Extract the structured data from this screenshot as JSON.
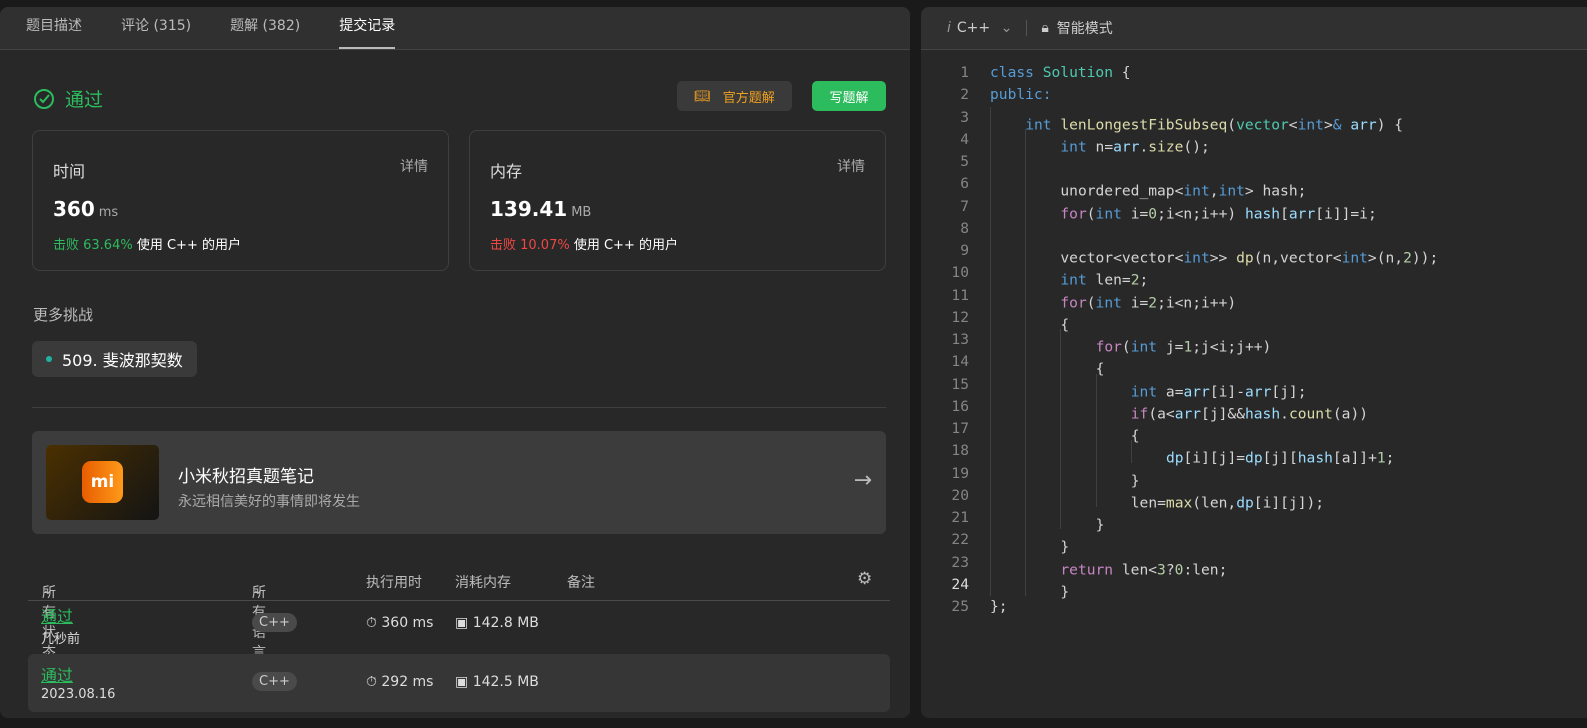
{
  "left": {
    "tabs": [
      {
        "label": "题目描述"
      },
      {
        "label": "评论 (315)"
      },
      {
        "label": "题解 (382)"
      },
      {
        "label": "提交记录",
        "active": true
      }
    ],
    "status": "通过",
    "official_button": "官方题解",
    "write_button": "写题解",
    "time_card": {
      "label": "时间",
      "detail": "详情",
      "value": "360",
      "unit": "ms",
      "beat_label": "击败 63.64%",
      "beat_suffix": "使用 C++ 的用户",
      "beat_color": "#2cbb5d"
    },
    "memory_card": {
      "label": "内存",
      "detail": "详情",
      "value": "139.41",
      "unit": "MB",
      "beat_label": "击败 10.07%",
      "beat_suffix": "使用 C++ 的用户",
      "beat_color": "#ef4743"
    },
    "more_challenges": "更多挑战",
    "challenge": "509. 斐波那契数",
    "banner": {
      "logo": "mi",
      "title": "小米秋招真题笔记",
      "subtitle": "永远相信美好的事情即将发生"
    },
    "table": {
      "headers": {
        "status": "所有状态",
        "language": "所有语言",
        "runtime": "执行用时",
        "memory": "消耗内存",
        "note": "备注"
      },
      "rows": [
        {
          "status": "通过",
          "time": "几秒前",
          "language": "C++",
          "runtime": "360 ms",
          "memory": "142.8 MB"
        },
        {
          "status": "通过",
          "time": "2023.08.16",
          "language": "C++",
          "runtime": "292 ms",
          "memory": "142.5 MB"
        }
      ]
    }
  },
  "editor": {
    "language": "C++",
    "mode": "智能模式",
    "current_line": 24,
    "lines": [
      [
        [
          "kw",
          "class "
        ],
        [
          "ty",
          "Solution"
        ],
        [
          "p",
          " {"
        ]
      ],
      [
        [
          "kw",
          "public:"
        ]
      ],
      [
        [
          "p",
          "    "
        ],
        [
          "kw",
          "int "
        ],
        [
          "fn",
          "lenLongestFibSubseq"
        ],
        [
          "p",
          "("
        ],
        [
          "ty",
          "vector"
        ],
        [
          "p",
          "<"
        ],
        [
          "kw",
          "int"
        ],
        [
          "p",
          ">"
        ],
        [
          "kw",
          "& "
        ],
        [
          "var",
          "arr"
        ],
        [
          "p",
          ") {"
        ]
      ],
      [
        [
          "p",
          "        "
        ],
        [
          "kw",
          "int "
        ],
        [
          "p",
          "n="
        ],
        [
          "var",
          "arr"
        ],
        [
          "p",
          "."
        ],
        [
          "fn",
          "size"
        ],
        [
          "p",
          "();"
        ]
      ],
      [
        [
          "p",
          "        "
        ]
      ],
      [
        [
          "p",
          "        unordered_map<"
        ],
        [
          "kw",
          "int"
        ],
        [
          "p",
          ","
        ],
        [
          "kw",
          "int"
        ],
        [
          "p",
          "> hash;"
        ]
      ],
      [
        [
          "p",
          "        "
        ],
        [
          "ctl",
          "for"
        ],
        [
          "p",
          "("
        ],
        [
          "kw",
          "int "
        ],
        [
          "p",
          "i="
        ],
        [
          "num",
          "0"
        ],
        [
          "p",
          ";i<n;i++) "
        ],
        [
          "var",
          "hash"
        ],
        [
          "p",
          "["
        ],
        [
          "var",
          "arr"
        ],
        [
          "p",
          "[i]]=i;"
        ]
      ],
      [
        [
          "p",
          "        "
        ]
      ],
      [
        [
          "p",
          "        vector<vector<"
        ],
        [
          "kw",
          "int"
        ],
        [
          "p",
          ">> "
        ],
        [
          "fn",
          "dp"
        ],
        [
          "p",
          "(n,vector<"
        ],
        [
          "kw",
          "int"
        ],
        [
          "p",
          ">(n,"
        ],
        [
          "num",
          "2"
        ],
        [
          "p",
          "));"
        ]
      ],
      [
        [
          "p",
          "        "
        ],
        [
          "kw",
          "int "
        ],
        [
          "p",
          "len="
        ],
        [
          "num",
          "2"
        ],
        [
          "p",
          ";"
        ]
      ],
      [
        [
          "p",
          "        "
        ],
        [
          "ctl",
          "for"
        ],
        [
          "p",
          "("
        ],
        [
          "kw",
          "int "
        ],
        [
          "p",
          "i="
        ],
        [
          "num",
          "2"
        ],
        [
          "p",
          ";i<n;i++)"
        ]
      ],
      [
        [
          "p",
          "        {"
        ]
      ],
      [
        [
          "p",
          "            "
        ],
        [
          "ctl",
          "for"
        ],
        [
          "p",
          "("
        ],
        [
          "kw",
          "int "
        ],
        [
          "p",
          "j="
        ],
        [
          "num",
          "1"
        ],
        [
          "p",
          ";j<i;j++)"
        ]
      ],
      [
        [
          "p",
          "            {"
        ]
      ],
      [
        [
          "p",
          "                "
        ],
        [
          "kw",
          "int "
        ],
        [
          "p",
          "a="
        ],
        [
          "var",
          "arr"
        ],
        [
          "p",
          "[i]-"
        ],
        [
          "var",
          "arr"
        ],
        [
          "p",
          "[j];"
        ]
      ],
      [
        [
          "p",
          "                "
        ],
        [
          "ctl",
          "if"
        ],
        [
          "p",
          "(a<"
        ],
        [
          "var",
          "arr"
        ],
        [
          "p",
          "[j]&&"
        ],
        [
          "var",
          "hash"
        ],
        [
          "p",
          "."
        ],
        [
          "fn",
          "count"
        ],
        [
          "p",
          "(a))"
        ]
      ],
      [
        [
          "p",
          "                {"
        ]
      ],
      [
        [
          "p",
          "                    "
        ],
        [
          "var",
          "dp"
        ],
        [
          "p",
          "[i][j]="
        ],
        [
          "var",
          "dp"
        ],
        [
          "p",
          "[j]["
        ],
        [
          "var",
          "hash"
        ],
        [
          "p",
          "[a]]+"
        ],
        [
          "num",
          "1"
        ],
        [
          "p",
          ";"
        ]
      ],
      [
        [
          "p",
          "                }"
        ]
      ],
      [
        [
          "p",
          "                len="
        ],
        [
          "fn",
          "max"
        ],
        [
          "p",
          "(len,"
        ],
        [
          "var",
          "dp"
        ],
        [
          "p",
          "[i][j]);"
        ]
      ],
      [
        [
          "p",
          "            }"
        ]
      ],
      [
        [
          "p",
          "        }"
        ]
      ],
      [
        [
          "p",
          "        "
        ],
        [
          "ctl",
          "return "
        ],
        [
          "p",
          "len<"
        ],
        [
          "num",
          "3"
        ],
        [
          "p",
          "?"
        ],
        [
          "num",
          "0"
        ],
        [
          "p",
          ":len;"
        ]
      ],
      [
        [
          "p",
          "        }"
        ]
      ],
      [
        [
          "p",
          "};"
        ]
      ]
    ]
  }
}
